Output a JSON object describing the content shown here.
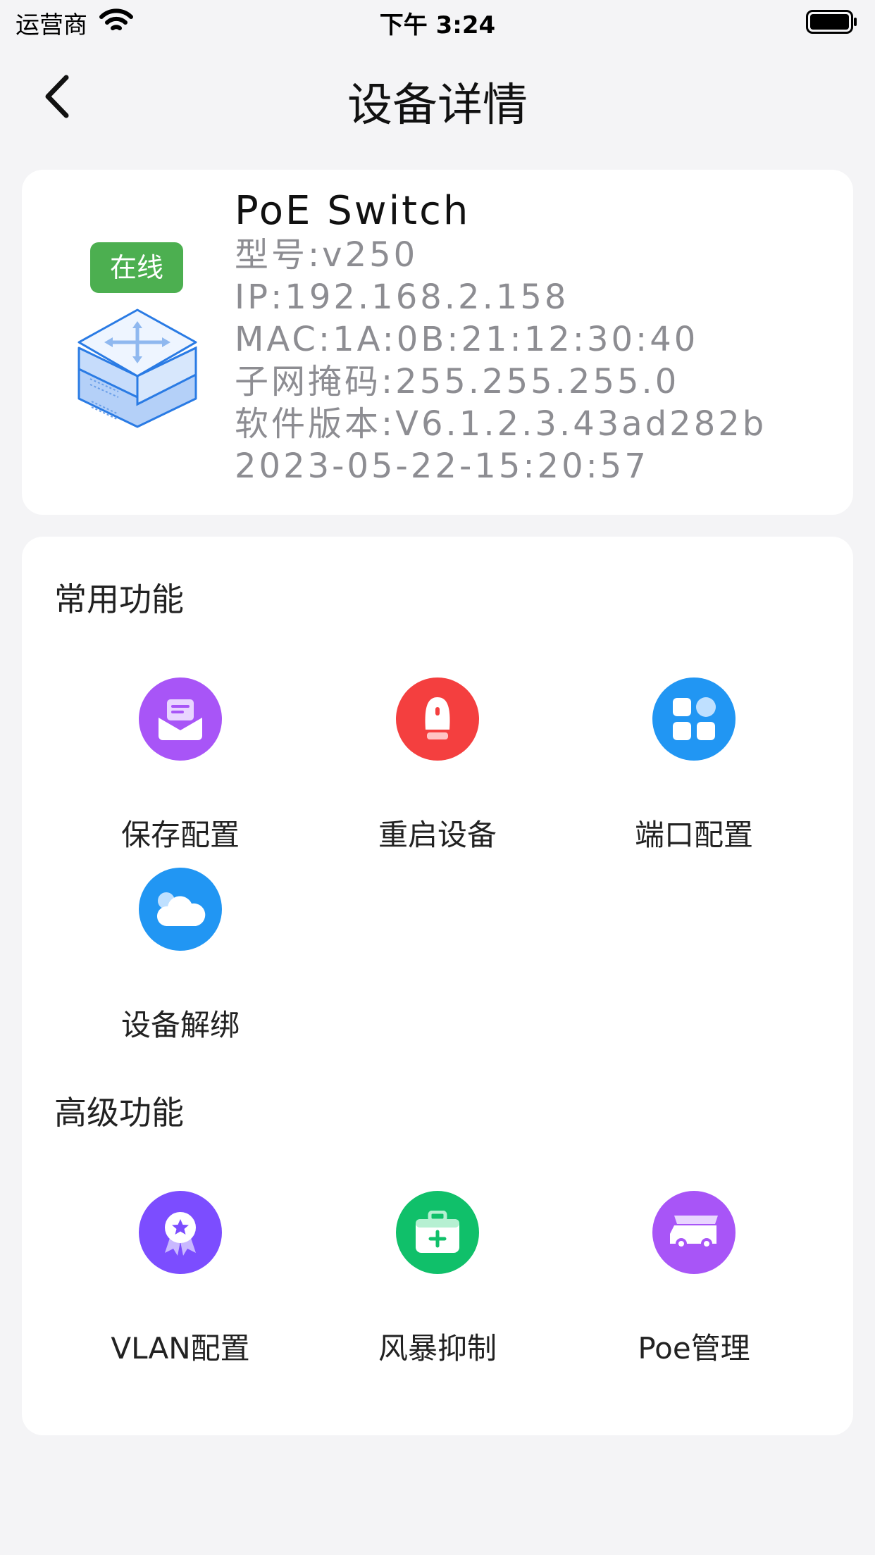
{
  "status_bar": {
    "carrier": "运营商",
    "time": "下午 3:24"
  },
  "nav": {
    "title": "设备详情"
  },
  "device": {
    "status": "在线",
    "name": "PoE Switch",
    "model": "型号:v250",
    "ip": "IP:192.168.2.158",
    "mac": "MAC:1A:0B:21:12:30:40",
    "mask": "子网掩码:255.255.255.0",
    "firmware": "软件版本:V6.1.2.3.43ad282b",
    "datetime": "2023-05-22-15:20:57"
  },
  "common": {
    "title": "常用功能",
    "items": [
      {
        "label": "保存配置",
        "icon": "save-icon",
        "color": "#a855f7"
      },
      {
        "label": "重启设备",
        "icon": "reboot-icon",
        "color": "#f43f3f"
      },
      {
        "label": "端口配置",
        "icon": "port-icon",
        "color": "#2196f3"
      },
      {
        "label": "设备解绑",
        "icon": "cloud-icon",
        "color": "#2196f3"
      }
    ]
  },
  "advanced": {
    "title": "高级功能",
    "items": [
      {
        "label": "VLAN配置",
        "icon": "vlan-icon",
        "color": "#7c4dff"
      },
      {
        "label": "风暴抑制",
        "icon": "storm-icon",
        "color": "#10c06a"
      },
      {
        "label": "Poe管理",
        "icon": "poe-icon",
        "color": "#a855f7"
      }
    ]
  }
}
